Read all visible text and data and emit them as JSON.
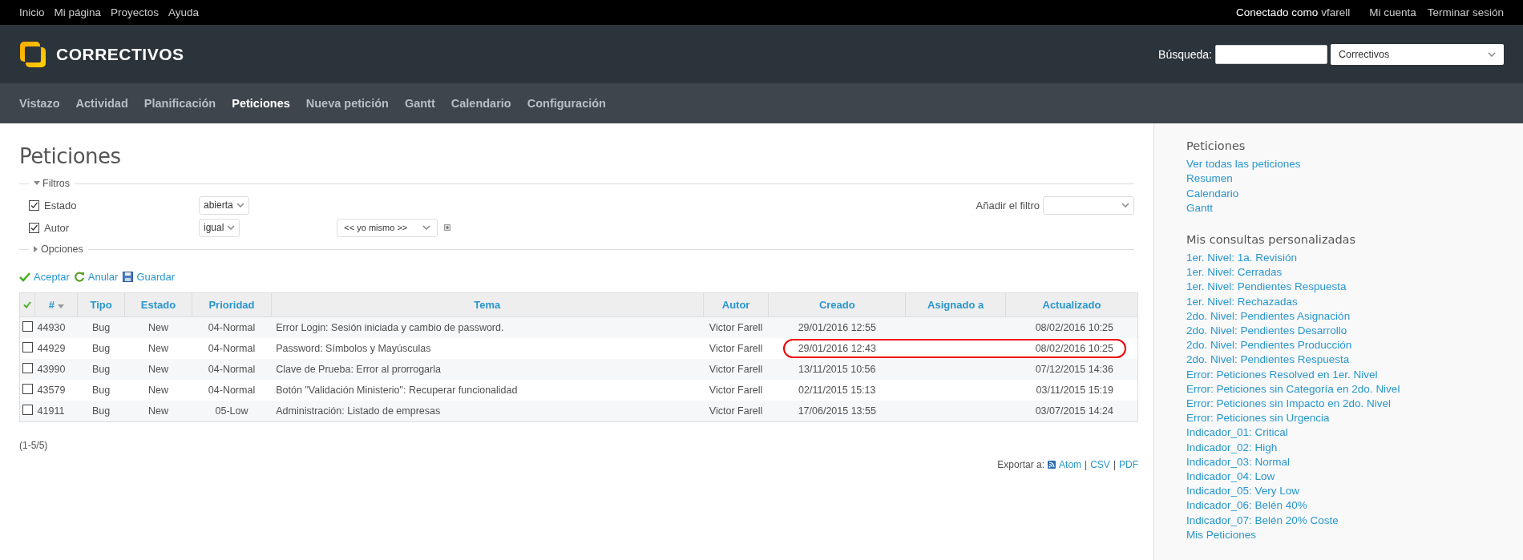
{
  "top_menu": {
    "left": [
      "Inicio",
      "Mi página",
      "Proyectos",
      "Ayuda"
    ],
    "logged_in_label": "Conectado como",
    "user": "vfarell",
    "right": [
      "Mi cuenta",
      "Terminar sesión"
    ]
  },
  "header": {
    "project": "CORRECTIVOS",
    "search_label": "Búsqueda:",
    "scope": "Correctivos"
  },
  "main_menu": [
    {
      "label": "Vistazo",
      "selected": false
    },
    {
      "label": "Actividad",
      "selected": false
    },
    {
      "label": "Planificación",
      "selected": false
    },
    {
      "label": "Peticiones",
      "selected": true
    },
    {
      "label": "Nueva petición",
      "selected": false
    },
    {
      "label": "Gantt",
      "selected": false
    },
    {
      "label": "Calendario",
      "selected": false
    },
    {
      "label": "Configuración",
      "selected": false
    }
  ],
  "page_title": "Peticiones",
  "filters": {
    "legend": "Filtros",
    "expanded": true,
    "rows": [
      {
        "label": "Estado",
        "checked": true,
        "operator": "abierta"
      },
      {
        "label": "Autor",
        "checked": true,
        "operator": "igual",
        "value": "<< yo mismo >>"
      }
    ],
    "add_filter_label": "Añadir el filtro"
  },
  "options": {
    "legend": "Opciones",
    "expanded": false
  },
  "actions": [
    {
      "kind": "apply",
      "label": "Aceptar"
    },
    {
      "kind": "reset",
      "label": "Anular"
    },
    {
      "kind": "save",
      "label": "Guardar"
    }
  ],
  "table": {
    "columns": [
      {
        "label": "#",
        "sorted": true
      },
      {
        "label": "Tipo",
        "sorted": false
      },
      {
        "label": "Estado",
        "sorted": false
      },
      {
        "label": "Prioridad",
        "sorted": false
      },
      {
        "label": "Tema",
        "sorted": false
      },
      {
        "label": "Autor",
        "sorted": false
      },
      {
        "label": "Creado",
        "sorted": false
      },
      {
        "label": "Asignado a",
        "sorted": false
      },
      {
        "label": "Actualizado",
        "sorted": false
      }
    ],
    "rows": [
      {
        "selected": false,
        "circled": false,
        "cells": [
          "44930",
          "Bug",
          "New",
          "04-Normal",
          "Error Login: Sesión iniciada y cambio de password.",
          "Victor Farell",
          "29/01/2016 12:55",
          "",
          "08/02/2016 10:25"
        ]
      },
      {
        "selected": false,
        "circled": true,
        "cells": [
          "44929",
          "Bug",
          "New",
          "04-Normal",
          "Password: Símbolos y Mayúsculas",
          "Victor Farell",
          "29/01/2016 12:43",
          "",
          "08/02/2016 10:25"
        ]
      },
      {
        "selected": false,
        "circled": false,
        "cells": [
          "43990",
          "Bug",
          "New",
          "04-Normal",
          "Clave de Prueba: Error al prorrogarla",
          "Victor Farell",
          "13/11/2015 10:56",
          "",
          "07/12/2015 14:36"
        ]
      },
      {
        "selected": false,
        "circled": false,
        "cells": [
          "43579",
          "Bug",
          "New",
          "04-Normal",
          "Botón \"Validación Ministerio\": Recuperar funcionalidad",
          "Victor Farell",
          "02/11/2015 15:13",
          "",
          "03/11/2015 15:19"
        ]
      },
      {
        "selected": false,
        "circled": false,
        "cells": [
          "41911",
          "Bug",
          "New",
          "05-Low",
          "Administración: Listado de empresas",
          "Victor Farell",
          "17/06/2015 13:55",
          "",
          "03/07/2015 14:24"
        ]
      }
    ]
  },
  "count": "(1-5/5)",
  "export": {
    "label": "Exportar a:",
    "links": [
      "Atom",
      "CSV",
      "PDF"
    ],
    "separator": "|"
  },
  "sidebar": [
    {
      "title": "Peticiones",
      "links": [
        "Ver todas las peticiones",
        "Resumen",
        "Calendario",
        "Gantt"
      ]
    },
    {
      "title": "Mis consultas personalizadas",
      "links": [
        "1er. Nivel: 1a. Revisión",
        "1er. Nivel: Cerradas",
        "1er. Nivel: Pendientes Respuesta",
        "1er. Nivel: Rechazadas",
        "2do. Nivel: Pendientes Asignación",
        "2do. Nivel: Pendientes Desarrollo",
        "2do. Nivel: Pendientes Producción",
        "2do. Nivel: Pendientes Respuesta",
        "Error: Peticiones Resolved en 1er. Nivel",
        "Error: Peticiones sin Categoría en 2do. Nivel",
        "Error: Peticiones sin Impacto en 2do. Nivel",
        "Error: Peticiones sin Urgencia",
        "Indicador_01: Critical",
        "Indicador_02: High",
        "Indicador_03: Normal",
        "Indicador_04: Low",
        "Indicador_05: Very Low",
        "Indicador_06: Belén 40%",
        "Indicador_07: Belén 20% Coste",
        "Mis Peticiones"
      ]
    }
  ]
}
